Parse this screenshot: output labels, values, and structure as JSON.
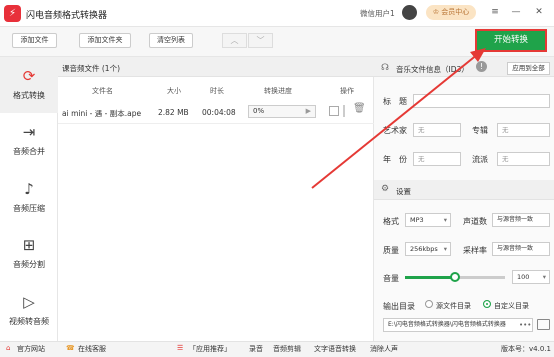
{
  "app": {
    "title": "闪电音频格式转换器",
    "logo_glyph": "⚡"
  },
  "header": {
    "user": "微信用户1",
    "vip": "会员中心",
    "win_controls": [
      "≡",
      "—",
      "✕"
    ]
  },
  "toolbar": {
    "add_file": "添加文件",
    "add_folder": "添加文件夹",
    "clear": "清空列表",
    "start": "开始转换"
  },
  "sidebar": {
    "items": [
      {
        "label": "格式转换",
        "icon": "⟳"
      },
      {
        "label": "音频合并",
        "icon": "⇥"
      },
      {
        "label": "音频压缩",
        "icon": "♪"
      },
      {
        "label": "音频分割",
        "icon": "⊞"
      },
      {
        "label": "视频转音频",
        "icon": "▷"
      }
    ]
  },
  "list": {
    "header": "课音频文件 (1个)",
    "columns": [
      "文件名",
      "大小",
      "时长",
      "转换进度",
      "操作"
    ],
    "rows": [
      {
        "name": "ai mini - 遇 - 副本.ape",
        "size": "2.82 MB",
        "duration": "00:04:08",
        "progress": "0%"
      }
    ]
  },
  "info": {
    "title": "音乐文件信息（ID3）",
    "apply_all": "应用到全部",
    "title_label": "标　题",
    "artist_label": "艺术家",
    "artist_ph": "无",
    "album_label": "专辑",
    "album_ph": "无",
    "year_label": "年　份",
    "year_ph": "无",
    "genre_label": "流派",
    "genre_ph": "无"
  },
  "settings": {
    "title": "设置",
    "format_label": "格式",
    "format": "MP3",
    "channel_label": "声道数",
    "channel": "与源音频一致",
    "quality_label": "质量",
    "quality": "256kbps",
    "sample_label": "采样率",
    "sample": "与源音频一致",
    "volume_label": "音量",
    "volume": "100",
    "volume_level": 0.5,
    "output_label": "输出目录",
    "out_src": "源文件目录",
    "out_custom": "自定义目录",
    "path": "E:\\闪电音频格式转换器\\闪电音频格式转换器"
  },
  "statusbar": {
    "website": "官方网站",
    "support": "在线客服",
    "promo": "「应用推荐」",
    "recording": "录音",
    "edit": "音频剪辑",
    "tts": "文字语音转换",
    "vocal": "消除人声",
    "version": "版本号：v4.0.1"
  }
}
